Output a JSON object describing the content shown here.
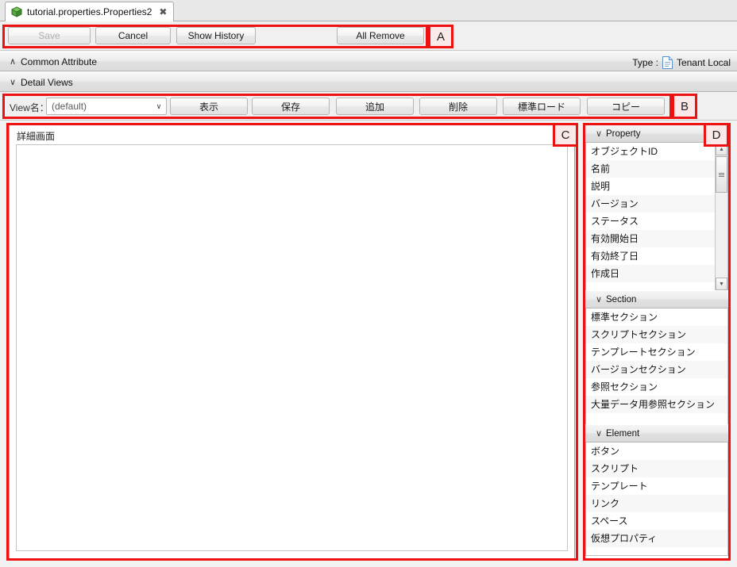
{
  "tab": {
    "icon": "green-cube-icon",
    "title": "tutorial.properties.Properties2",
    "close": "✖"
  },
  "toolbar": {
    "save_label": "Save",
    "cancel_label": "Cancel",
    "show_history_label": "Show History",
    "all_remove_label": "All Remove"
  },
  "common_attribute": {
    "chevron": "∧",
    "title": "Common Attribute",
    "type_label": "Type :",
    "type_value": "Tenant Local",
    "type_icon": "document-icon"
  },
  "detail_views": {
    "chevron": "∨",
    "title": "Detail Views"
  },
  "view_row": {
    "view_name_label": "View名：",
    "combo_value": "(default)",
    "combo_arrow": "∨",
    "buttons": [
      {
        "label": "表示"
      },
      {
        "label": "保存"
      },
      {
        "label": "追加"
      },
      {
        "label": "削除"
      },
      {
        "label": "標準ロード"
      },
      {
        "label": "コピー"
      }
    ]
  },
  "detail_panel": {
    "title": "詳細画面"
  },
  "palette": {
    "property": {
      "chevron": "∨",
      "title": "Property",
      "items": [
        "オブジェクトID",
        "名前",
        "説明",
        "バージョン",
        "ステータス",
        "有効開始日",
        "有効終了日",
        "作成日"
      ],
      "scroll_up": "▲",
      "scroll_down": "▼"
    },
    "section": {
      "chevron": "∨",
      "title": "Section",
      "items": [
        "標準セクション",
        "スクリプトセクション",
        "テンプレートセクション",
        "バージョンセクション",
        "参照セクション",
        "大量データ用参照セクション"
      ]
    },
    "element": {
      "chevron": "∨",
      "title": "Element",
      "items": [
        "ボタン",
        "スクリプト",
        "テンプレート",
        "リンク",
        "スペース",
        "仮想プロパティ"
      ]
    }
  },
  "annotations": [
    {
      "letter": "A"
    },
    {
      "letter": "B"
    },
    {
      "letter": "C"
    },
    {
      "letter": "D"
    }
  ],
  "colors": {
    "annotation_red": "#ee1111",
    "annotation_fill": "#fbe8e8",
    "panel_bg": "#f0f0f0",
    "tab_icon_green": "#4fa33b"
  }
}
